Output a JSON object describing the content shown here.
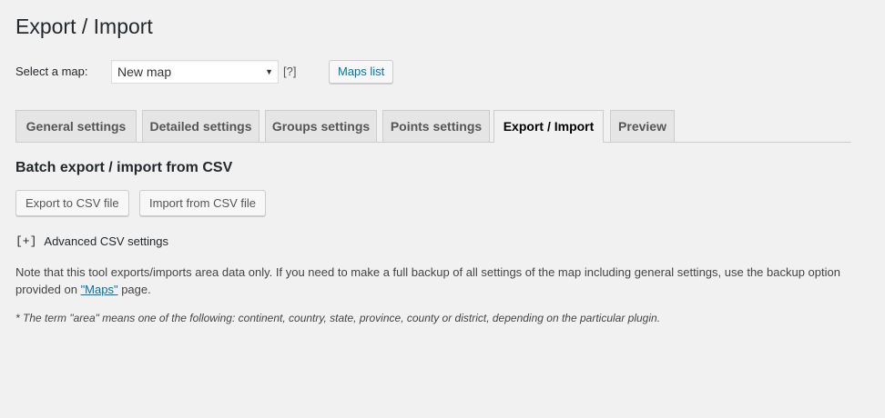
{
  "page": {
    "title": "Export / Import"
  },
  "map_selector": {
    "label": "Select a map:",
    "selected": "New map",
    "arrow": "▼",
    "help": "[?]",
    "maps_list_button": "Maps list"
  },
  "tabs": [
    {
      "label": "General settings",
      "active": false
    },
    {
      "label": "Detailed settings",
      "active": false
    },
    {
      "label": "Groups settings",
      "active": false
    },
    {
      "label": "Points settings",
      "active": false
    },
    {
      "label": "Export / Import",
      "active": true
    },
    {
      "label": "Preview",
      "active": false
    }
  ],
  "section": {
    "title": "Batch export / import from CSV",
    "export_button": "Export to CSV file",
    "import_button": "Import from CSV file",
    "advanced_toggle": "[+]",
    "advanced_label": "Advanced CSV settings"
  },
  "note": {
    "text_before": "Note that this tool exports/imports area data only. If you need to make a full backup of all settings of the map including general settings, use the backup option provided on ",
    "link_text": "\"Maps\"",
    "text_after": " page."
  },
  "footnote": {
    "text": "* The term \"area\" means one of the following: continent, country, state, province, county or district, depending on the particular plugin."
  },
  "colors": {
    "background": "#f1f1f1",
    "link": "#0073aa",
    "text": "#23282d"
  }
}
